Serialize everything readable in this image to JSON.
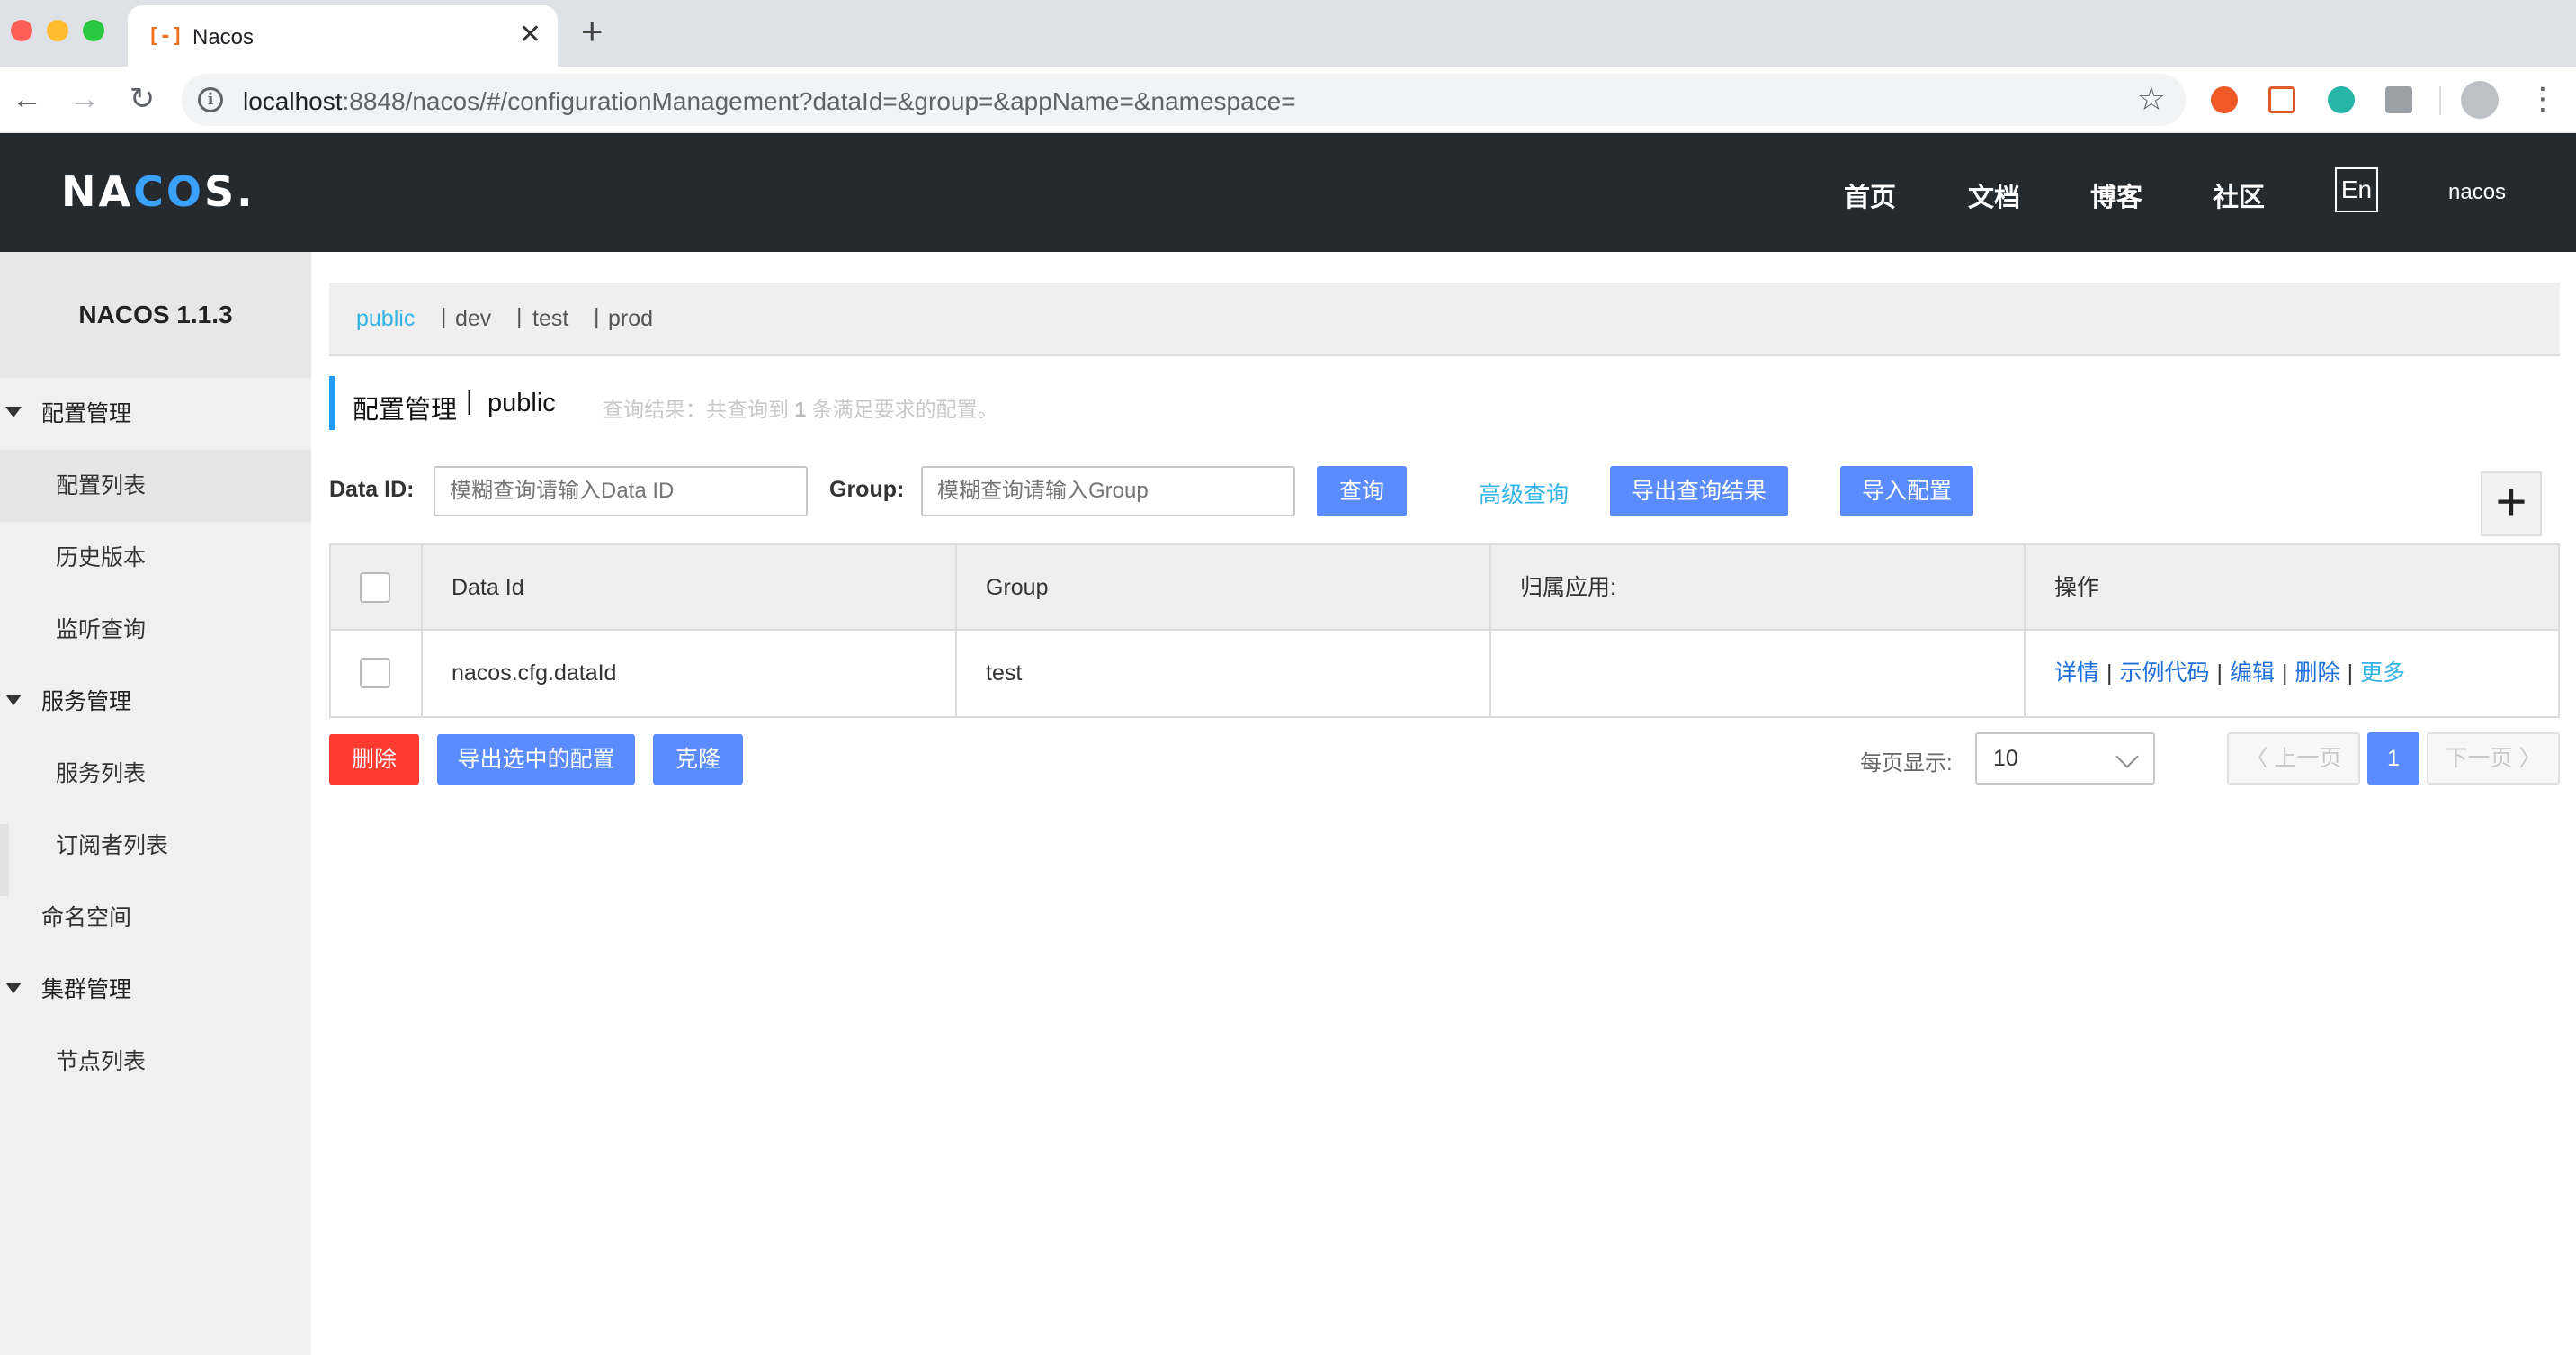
{
  "browser": {
    "tab_title": "Nacos",
    "tab_favicon": "[-]",
    "tab_close": "✕",
    "new_tab": "+",
    "url_host": "localhost",
    "url_rest": ":8848/nacos/#/configurationManagement?dataId=&group=&appName=&namespace=",
    "back_icon": "←",
    "forward_icon": "→",
    "reload_icon": "↻",
    "star_icon": "☆",
    "info_icon": "i",
    "menu_icon": "⋮"
  },
  "header": {
    "logo_prefix": "NA",
    "logo_mid": "CO",
    "logo_suffix": "S.",
    "nav": [
      "首页",
      "文档",
      "博客",
      "社区"
    ],
    "lang_button": "En",
    "user": "nacos"
  },
  "sidebar": {
    "title": "NACOS 1.1.3",
    "groups": {
      "config": "配置管理",
      "service": "服务管理",
      "namespace": "命名空间",
      "cluster": "集群管理"
    },
    "items": {
      "config_list": "配置列表",
      "history": "历史版本",
      "listener": "监听查询",
      "service_list": "服务列表",
      "subscriber_list": "订阅者列表",
      "node_list": "节点列表"
    }
  },
  "namespaces": {
    "active": "public",
    "others": [
      "dev",
      "test",
      "prod"
    ],
    "separator": "|"
  },
  "page": {
    "title": "配置管理",
    "separator": "|",
    "namespace": "public",
    "result_prefix": "查询结果：共查询到",
    "result_count": "1",
    "result_suffix": "条满足要求的配置。"
  },
  "search": {
    "data_id_label": "Data ID:",
    "data_id_placeholder": "模糊查询请输入Data ID",
    "group_label": "Group:",
    "group_placeholder": "模糊查询请输入Group",
    "query_button": "查询",
    "advanced_link": "高级查询",
    "export_results_button": "导出查询结果",
    "import_button": "导入配置",
    "add_button": "+"
  },
  "table": {
    "headers": [
      "Data Id",
      "Group",
      "归属应用:",
      "操作"
    ],
    "rows": [
      {
        "data_id": "nacos.cfg.dataId",
        "group": "test",
        "app": "",
        "ops": [
          "详情",
          "示例代码",
          "编辑",
          "删除",
          "更多"
        ]
      }
    ],
    "op_separator": "|"
  },
  "actions": {
    "delete_button": "删除",
    "export_selected_button": "导出选中的配置",
    "clone_button": "克隆"
  },
  "pagination": {
    "page_size_label": "每页显示:",
    "page_size": "10",
    "prev_label": "〈 上一页",
    "current_page": "1",
    "next_label": "下一页 〉"
  },
  "colors": {
    "header_bg": "#252a2f",
    "primary_button": "#5a8cff",
    "danger_button": "#ff3b30",
    "link": "#1e6fd9",
    "accent_link": "#33b4e6"
  }
}
